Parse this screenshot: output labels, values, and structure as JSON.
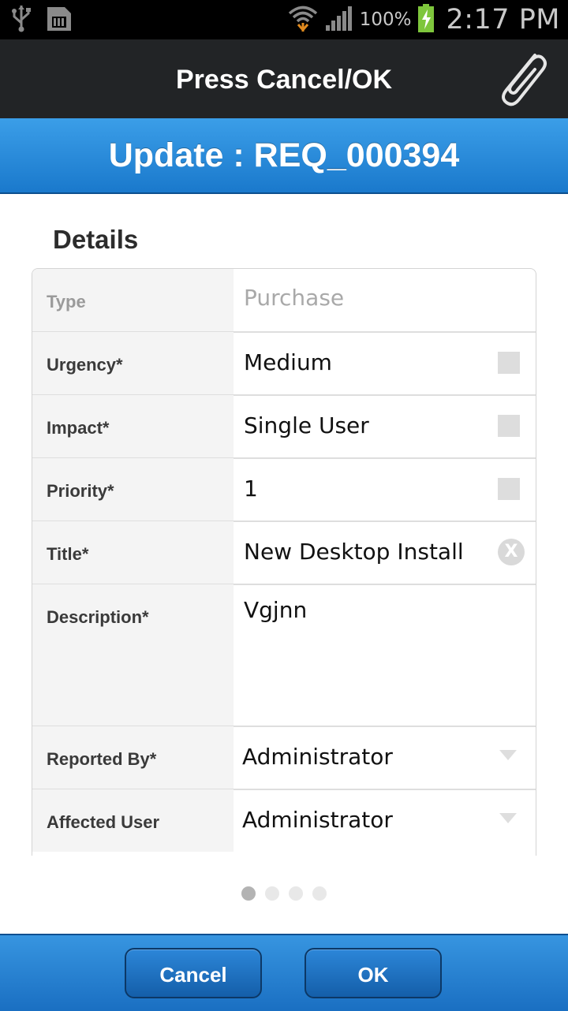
{
  "status_bar": {
    "icons_left": [
      "usb-icon",
      "sd-card-icon"
    ],
    "icons_right": [
      "wifi-icon",
      "signal-icon",
      "battery-charging-icon"
    ],
    "battery_percent": "100%",
    "time": "2:17 PM"
  },
  "action_bar": {
    "title": "Press Cancel/OK",
    "attach_icon": "paperclip-icon"
  },
  "header": {
    "title": "Update : REQ_000394"
  },
  "section": {
    "title": "Details"
  },
  "fields": {
    "type": {
      "label": "Type",
      "placeholder": "Purchase"
    },
    "urgency": {
      "label": "Urgency*",
      "value": "Medium"
    },
    "impact": {
      "label": "Impact*",
      "value": "Single User"
    },
    "priority": {
      "label": "Priority*",
      "value": "1"
    },
    "title": {
      "label": "Title*",
      "value": "New Desktop Install",
      "clear_symbol": "X"
    },
    "description": {
      "label": "Description*",
      "value": "Vgjnn"
    },
    "reported_by": {
      "label": "Reported By*",
      "value": "Administrator"
    },
    "affected_user": {
      "label": "Affected User",
      "value": "Administrator"
    }
  },
  "pager": {
    "pages": 4,
    "current": 1
  },
  "buttons": {
    "cancel": "Cancel",
    "ok": "OK"
  },
  "colors": {
    "header_blue": "#2a8ddd",
    "action_bar": "#222426",
    "button_blue": "#1f74c6"
  }
}
